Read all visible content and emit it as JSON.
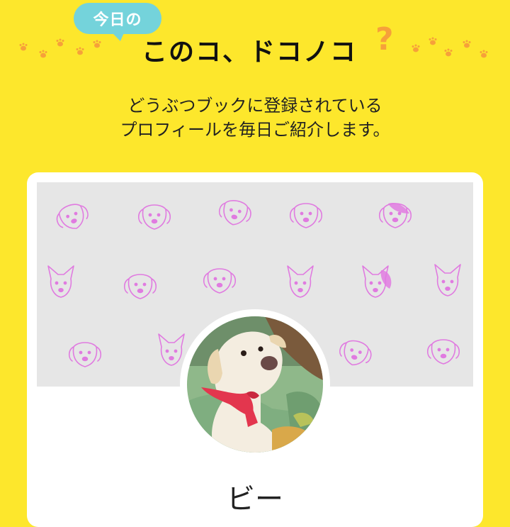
{
  "header": {
    "bubble_text": "今日の",
    "title": "このコ、ドコノコ",
    "title_accent": "?"
  },
  "intro": {
    "line1": "どうぶつブックに登録されている",
    "line2": "プロフィールを毎日ご紹介します。"
  },
  "profile": {
    "name": "ビー"
  },
  "colors": {
    "background": "#fde72c",
    "bubble": "#74d3db",
    "accent": "#f6a13a",
    "doodle": "#e07be0",
    "cover": "#e6e6e6"
  },
  "icons": [
    "paw-print-icon",
    "dog-doodle-icon"
  ]
}
